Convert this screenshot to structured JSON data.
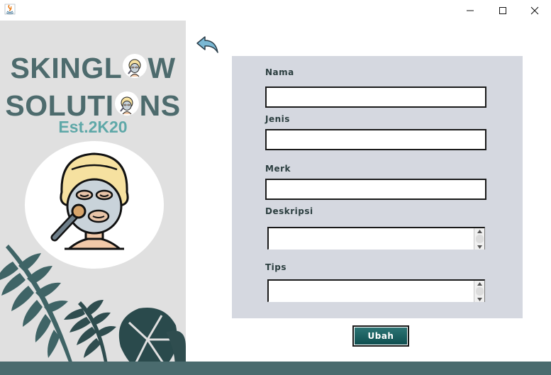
{
  "window": {
    "controls": {
      "minimize": "—",
      "maximize": "☐",
      "close": "✕"
    }
  },
  "brand": {
    "line1_before_o": "SKINGL",
    "line1_after_o": "W",
    "line2_before_o": "SOLUTI",
    "line2_after_o": "NS",
    "established": "Est.2K20",
    "colors": {
      "primary": "#4d6b6d",
      "accent": "#5fa8a8"
    }
  },
  "form": {
    "fields": [
      {
        "label": "Nama",
        "value": ""
      },
      {
        "label": "Jenis",
        "value": ""
      },
      {
        "label": "Merk",
        "value": ""
      }
    ],
    "textareas": [
      {
        "label": "Deskripsi",
        "value": ""
      },
      {
        "label": "Tips",
        "value": ""
      }
    ],
    "submit_label": "Ubah"
  },
  "colors": {
    "card_bg": "#d5d8e0",
    "button": "#1a5e5f",
    "bottom_bar": "#4a6b6e",
    "back_arrow": "#7ab8d4"
  },
  "icons": {
    "app": "java-icon",
    "back": "back-arrow-icon",
    "mascot": "face-mask-woman-icon"
  }
}
